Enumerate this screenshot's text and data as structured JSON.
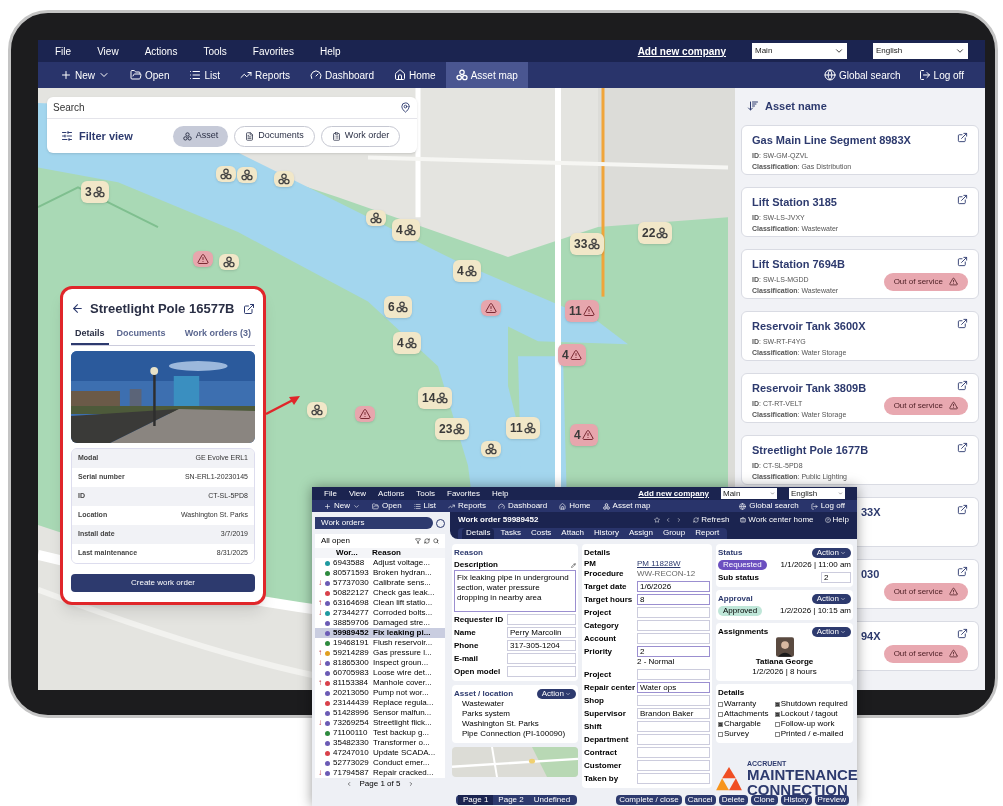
{
  "menu": [
    "File",
    "View",
    "Actions",
    "Tools",
    "Favorites",
    "Help"
  ],
  "add_company": "Add new company",
  "selects": [
    "Main",
    "English"
  ],
  "nav": [
    {
      "label": "New",
      "kind": "new",
      "selected": false
    },
    {
      "label": "Open",
      "kind": "open",
      "selected": false
    },
    {
      "label": "List",
      "kind": "list",
      "selected": false
    },
    {
      "label": "Reports",
      "kind": "reports",
      "selected": false
    },
    {
      "label": "Dashboard",
      "kind": "dashboard",
      "selected": false
    },
    {
      "label": "Home",
      "kind": "home",
      "selected": false
    },
    {
      "label": "Asset map",
      "kind": "assetmap",
      "selected": true
    }
  ],
  "nav_right": [
    {
      "label": "Global search",
      "kind": "globe"
    },
    {
      "label": "Log off",
      "kind": "logoff"
    }
  ],
  "search": {
    "placeholder": "Search"
  },
  "filter": {
    "label": "Filter view",
    "options": [
      {
        "label": "Asset",
        "kind": "asset",
        "selected": true
      },
      {
        "label": "Documents",
        "kind": "documents",
        "selected": false
      },
      {
        "label": "Work order",
        "kind": "workorder",
        "selected": false
      }
    ]
  },
  "map_pins": [
    {
      "label": "3",
      "kind": "asset"
    },
    {
      "kind": "asset"
    },
    {
      "kind": "asset"
    },
    {
      "kind": "asset"
    },
    {
      "kind": "alert"
    },
    {
      "kind": "asset"
    },
    {
      "kind": "asset"
    },
    {
      "label": "4",
      "kind": "asset"
    },
    {
      "label": "33",
      "kind": "asset"
    },
    {
      "label": "22",
      "kind": "asset"
    },
    {
      "label": "4",
      "kind": "asset"
    },
    {
      "label": "6",
      "kind": "asset"
    },
    {
      "kind": "alert"
    },
    {
      "label": "11",
      "kind": "alert"
    },
    {
      "label": "4",
      "kind": "asset"
    },
    {
      "label": "4",
      "kind": "alert"
    },
    {
      "label": "14",
      "kind": "asset"
    },
    {
      "kind": "asset"
    },
    {
      "kind": "alert"
    },
    {
      "label": "23",
      "kind": "asset"
    },
    {
      "label": "11",
      "kind": "asset"
    },
    {
      "label": "4",
      "kind": "alert"
    },
    {
      "kind": "asset"
    }
  ],
  "popup": {
    "title": "Streetlight Pole 16577B",
    "tabs": [
      {
        "label": "Details",
        "selected": true
      },
      {
        "label": "Documents",
        "selected": false
      },
      {
        "label": "Work orders (3)",
        "selected": false
      }
    ],
    "details": [
      {
        "label": "Modal",
        "value": "GE Evolve ERL1"
      },
      {
        "label": "Serial number",
        "value": "SN-ERL1-20230145"
      },
      {
        "label": "ID",
        "value": "CT-SL-5PD8"
      },
      {
        "label": "Location",
        "value": "Washington St. Parks"
      },
      {
        "label": "Install date",
        "value": "3/7/2019"
      },
      {
        "label": "Last maintenance",
        "value": "8/31/2025"
      }
    ],
    "button": "Create work order"
  },
  "asset_list": {
    "header": "Asset name",
    "items": [
      {
        "kind": "full",
        "title": "Gas Main Line Segment 8983X",
        "id": "**ID**: SW-GM-QZVL",
        "classification": "**Classification**: Gas Distribution"
      },
      {
        "kind": "full",
        "title": "Lift Station 3185",
        "id": "**ID**: SW-LS-JVXY",
        "classification": "**Classification**: Wastewater"
      },
      {
        "kind": "full",
        "title": "Lift Station 7694B",
        "id": "**ID**: SW-LS-MGDD",
        "classification": "**Classification**: Wastewater",
        "status": "Out of service"
      },
      {
        "kind": "full",
        "title": "Reservoir Tank 3600X",
        "id": "**ID**: SW-RT-F4YG",
        "classification": "**Classification**: Water Storage"
      },
      {
        "kind": "full",
        "title": "Reservoir Tank 3809B",
        "id": "**ID**: CT-RT-VELT",
        "classification": "**Classification**: Water Storage",
        "status": "Out of service"
      },
      {
        "kind": "full",
        "title": "Streetlight Pole 1677B",
        "id": "**ID**: CT-SL-5PD8",
        "classification": "**Classification**: Public Lighting"
      },
      {
        "kind": "partial",
        "title": "33X"
      },
      {
        "kind": "partial",
        "title": "030",
        "status": "Out of service"
      },
      {
        "kind": "partial",
        "title": "94X",
        "status": "Out of service"
      }
    ]
  },
  "overlay": {
    "menu": [
      "File",
      "View",
      "Actions",
      "Tools",
      "Favorites",
      "Help"
    ],
    "add_company": "Add new company",
    "selects": [
      "Main",
      "English"
    ],
    "nav": [
      {
        "label": "New",
        "kind": "new"
      },
      {
        "label": "Open",
        "kind": "open"
      },
      {
        "label": "List",
        "kind": "list"
      },
      {
        "label": "Reports",
        "kind": "reports"
      },
      {
        "label": "Dashboard",
        "kind": "dashboard"
      },
      {
        "label": "Home",
        "kind": "home"
      },
      {
        "label": "Asset map",
        "kind": "assetmap"
      }
    ],
    "nav_right": [
      {
        "label": "Global search",
        "kind": "globe"
      },
      {
        "label": "Log off",
        "kind": "logoff"
      }
    ],
    "list_title": "Work orders",
    "list_filter": "All open",
    "columns": [
      "Wor...",
      "Reason"
    ],
    "rows": [
      {
        "number": "6943588",
        "reason": "Adjust voltage...",
        "color": "#1f9aa0",
        "selected": false
      },
      {
        "number": "80571593",
        "reason": "Broken hydran...",
        "color": "#2e8b3e",
        "selected": false
      },
      {
        "priority": "↓",
        "number": "57737030",
        "reason": "Calibrate sens...",
        "color": "#6b5bb5",
        "selected": false
      },
      {
        "number": "50822127",
        "reason": "Check gas leak...",
        "color": "#d9414a",
        "selected": false
      },
      {
        "priority": "↑",
        "number": "63164698",
        "reason": "Clean lift statio...",
        "color": "#6b5bb5",
        "selected": false
      },
      {
        "priority": "↓",
        "number": "27344277",
        "reason": "Corroded bolts...",
        "color": "#1f9aa0",
        "selected": false
      },
      {
        "number": "38859706",
        "reason": "Damaged stre...",
        "color": "#6b5bb5",
        "selected": false
      },
      {
        "number": "59989452",
        "reason": "Fix leaking pi...",
        "color": "#6b5bb5",
        "selected": true
      },
      {
        "number": "19468191",
        "reason": "Flush reservoir...",
        "color": "#2e8b3e",
        "selected": false
      },
      {
        "priority": "↑",
        "number": "59214289",
        "reason": "Gas pressure l...",
        "color": "#e0a020",
        "selected": false
      },
      {
        "priority": "↓",
        "number": "81865300",
        "reason": "Inspect groun...",
        "color": "#6b5bb5",
        "selected": false
      },
      {
        "number": "60705983",
        "reason": "Loose wire det...",
        "color": "#6b5bb5",
        "selected": false
      },
      {
        "priority": "↑",
        "number": "81153384",
        "reason": "Manhole cover...",
        "color": "#d9414a",
        "selected": false
      },
      {
        "number": "20213050",
        "reason": "Pump not wor...",
        "color": "#6b5bb5",
        "selected": false
      },
      {
        "number": "23144439",
        "reason": "Replace regula...",
        "color": "#d9414a",
        "selected": false
      },
      {
        "number": "51428996",
        "reason": "Sensor malfun...",
        "color": "#6b5bb5",
        "selected": false
      },
      {
        "priority": "↓",
        "number": "73269254",
        "reason": "Streetlight flick...",
        "color": "#6b5bb5",
        "selected": false
      },
      {
        "number": "71100110",
        "reason": "Test backup g...",
        "color": "#2e8b3e",
        "selected": false
      },
      {
        "number": "35482330",
        "reason": "Transformer o...",
        "color": "#6b5bb5",
        "selected": false
      },
      {
        "number": "47247010",
        "reason": "Update SCADA...",
        "color": "#d9414a",
        "selected": false
      },
      {
        "number": "52773029",
        "reason": "Conduct emer...",
        "color": "#6b5bb5",
        "selected": false
      },
      {
        "priority": "↓",
        "number": "71794587",
        "reason": "Repair cracked...",
        "color": "#6b5bb5",
        "selected": false
      }
    ],
    "pager": "Page 1 of 5",
    "title": "Work order 59989452",
    "header_actions": [
      {
        "label": "Refresh",
        "kind": "refresh"
      },
      {
        "label": "Work center home",
        "kind": "briefcase"
      },
      {
        "label": "Help",
        "kind": "help"
      }
    ],
    "tabs": [
      {
        "label": "Details",
        "selected": true
      },
      {
        "label": "Tasks",
        "selected": false
      },
      {
        "label": "Costs",
        "selected": false
      },
      {
        "label": "Attach",
        "selected": false
      },
      {
        "label": "History",
        "selected": false
      },
      {
        "label": "Assign",
        "selected": false
      },
      {
        "label": "Group",
        "selected": false
      },
      {
        "label": "Report",
        "selected": false
      }
    ],
    "reason": {
      "title": "Reason",
      "description_label": "Description",
      "description": "Fix leaking pipe in underground section, water pressure dropping in nearby area",
      "fields": [
        {
          "label": "Requester ID"
        },
        {
          "label": "Name",
          "value": "Perry Marcolin"
        },
        {
          "label": "Phone",
          "value": "317-305-1204"
        },
        {
          "label": "E-mail"
        },
        {
          "label": "Open model"
        }
      ]
    },
    "asset_location": {
      "title": "Asset / location",
      "action": "Action",
      "lines": [
        "Wastewater",
        "Parks system",
        "Washington St. Parks",
        "Pipe Connection (PI-100090)"
      ]
    },
    "details": {
      "title": "Details",
      "pm_label": "PM",
      "pm": "PM 11828W",
      "procedure_label": "Procedure",
      "procedure": "WW-RECON-12",
      "fields": [
        {
          "label": "Target date",
          "value": "1/6/2026",
          "highlight": true
        },
        {
          "label": "Target hours",
          "value": "8",
          "highlight": true
        },
        {
          "label": "Project",
          "highlight": false
        },
        {
          "label": "Category",
          "highlight": false
        },
        {
          "label": "Account",
          "highlight": false
        },
        {
          "label": "Priority",
          "value": "2",
          "note": "2 - Normal",
          "highlight": true
        },
        {
          "label": "Project",
          "highlight": false
        },
        {
          "label": "Repair center",
          "value": "Water ops",
          "highlight": true
        },
        {
          "label": "Shop",
          "highlight": false
        },
        {
          "label": "Supervisor",
          "value": "Brandon Baker",
          "highlight": false
        },
        {
          "label": "Shift",
          "highlight": false
        },
        {
          "label": "Department",
          "highlight": false
        },
        {
          "label": "Contract",
          "highlight": false
        },
        {
          "label": "Customer",
          "highlight": false
        },
        {
          "label": "Taken by",
          "highlight": false
        }
      ]
    },
    "status": {
      "title": "Status",
      "action": "Action",
      "badge": "Requested",
      "time": "1/1/2026 | 11:00 am",
      "sub_label": "Sub status",
      "sub_value": "2"
    },
    "approval": {
      "title": "Approval",
      "action": "Action",
      "badge": "Approved",
      "time": "1/2/2026 | 10:15 am"
    },
    "assignments": {
      "title": "Assignments",
      "action": "Action",
      "name": "Tatiana George",
      "time": "1/2/2026 | 8 hours"
    },
    "flags": {
      "title": "Details",
      "items": [
        {
          "label": "Warranty",
          "checked": false
        },
        {
          "label": "Shutdown required",
          "checked": true
        },
        {
          "label": "Attachments",
          "checked": false
        },
        {
          "label": "Lockout / tagout",
          "checked": true
        },
        {
          "label": "Chargable",
          "checked": true
        },
        {
          "label": "Follow-up work",
          "checked": false
        },
        {
          "label": "Survey",
          "checked": false
        },
        {
          "label": "Printed / e-mailed",
          "checked": false
        }
      ]
    },
    "pages": [
      {
        "label": "Page 1",
        "selected": true
      },
      {
        "label": "Page 2",
        "selected": false
      },
      {
        "label": "Undefined",
        "selected": false
      }
    ],
    "buttons": [
      "Complete / close",
      "Cancel",
      "Delete",
      "Clone",
      "History",
      "Preview"
    ]
  },
  "logo": {
    "brand": "ACCRUENT",
    "lines": [
      "MAINTENANCE",
      "CONNECTION"
    ]
  }
}
